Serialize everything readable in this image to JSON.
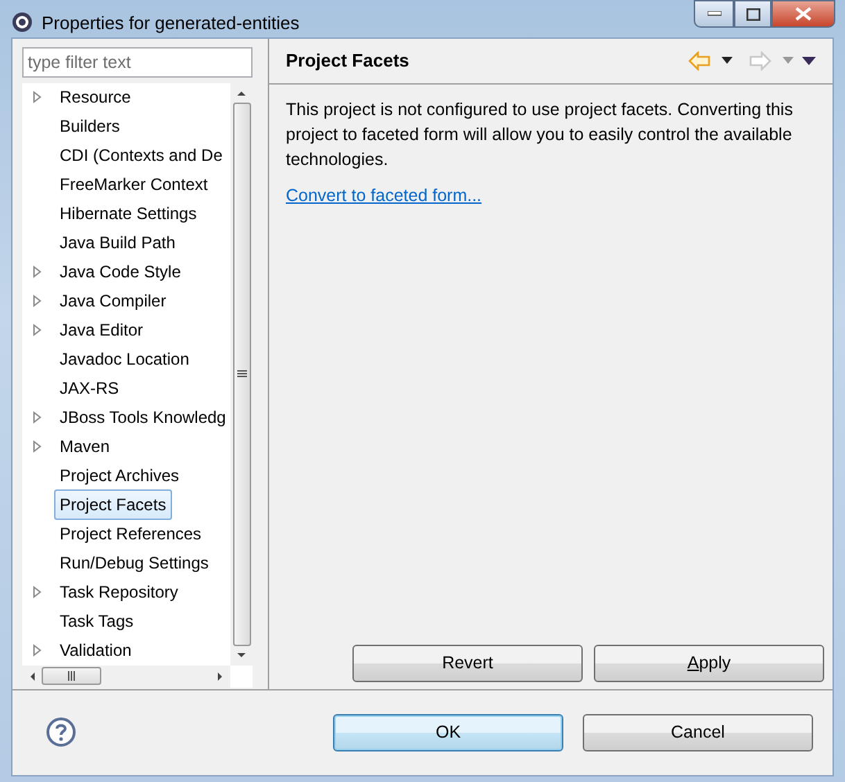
{
  "window": {
    "title": "Properties for generated-entities"
  },
  "filter": {
    "placeholder": "type filter text"
  },
  "tree": [
    {
      "label": "Resource",
      "expandable": true,
      "selected": false
    },
    {
      "label": "Builders",
      "expandable": false,
      "selected": false
    },
    {
      "label": "CDI (Contexts and De",
      "expandable": false,
      "selected": false
    },
    {
      "label": "FreeMarker Context",
      "expandable": false,
      "selected": false
    },
    {
      "label": "Hibernate Settings",
      "expandable": false,
      "selected": false
    },
    {
      "label": "Java Build Path",
      "expandable": false,
      "selected": false
    },
    {
      "label": "Java Code Style",
      "expandable": true,
      "selected": false
    },
    {
      "label": "Java Compiler",
      "expandable": true,
      "selected": false
    },
    {
      "label": "Java Editor",
      "expandable": true,
      "selected": false
    },
    {
      "label": "Javadoc Location",
      "expandable": false,
      "selected": false
    },
    {
      "label": "JAX-RS",
      "expandable": false,
      "selected": false
    },
    {
      "label": "JBoss Tools Knowledg",
      "expandable": true,
      "selected": false
    },
    {
      "label": "Maven",
      "expandable": true,
      "selected": false
    },
    {
      "label": "Project Archives",
      "expandable": false,
      "selected": false
    },
    {
      "label": "Project Facets",
      "expandable": false,
      "selected": true
    },
    {
      "label": "Project References",
      "expandable": false,
      "selected": false
    },
    {
      "label": "Run/Debug Settings",
      "expandable": false,
      "selected": false
    },
    {
      "label": "Task Repository",
      "expandable": true,
      "selected": false
    },
    {
      "label": "Task Tags",
      "expandable": false,
      "selected": false
    },
    {
      "label": "Validation",
      "expandable": true,
      "selected": false
    }
  ],
  "page": {
    "title": "Project Facets",
    "description": "This project is not configured to use project facets. Converting this project to faceted form will allow you to easily control the available technologies.",
    "link": "Convert to faceted form...",
    "nav": [
      {
        "kind": "back",
        "disabled": false
      },
      {
        "kind": "forward",
        "disabled": true
      }
    ]
  },
  "page_buttons": [
    "Revert",
    "Apply"
  ],
  "dialog_buttons": [
    {
      "label": "OK",
      "default": true
    },
    {
      "label": "Cancel",
      "default": false
    }
  ]
}
